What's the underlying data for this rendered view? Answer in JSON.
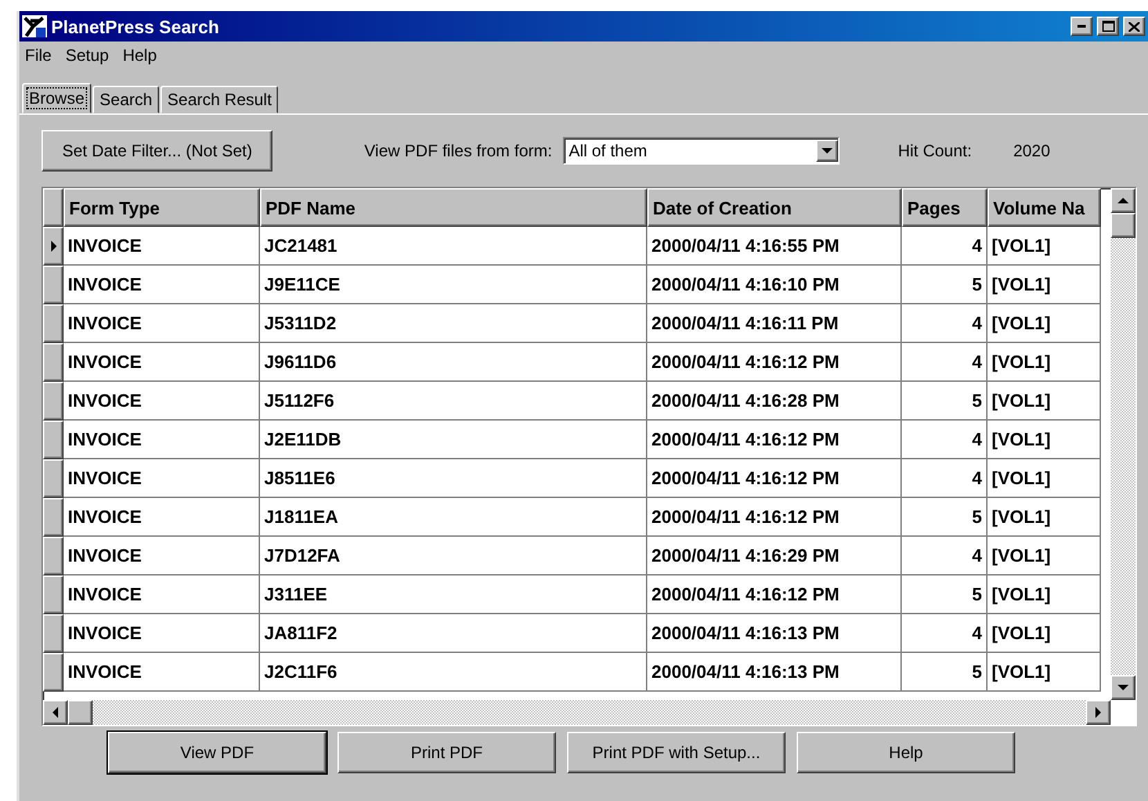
{
  "window": {
    "title": "PlanetPress Search"
  },
  "menu": [
    "File",
    "Setup",
    "Help"
  ],
  "tabs": [
    {
      "label": "Browse",
      "selected": true
    },
    {
      "label": "Search",
      "selected": false
    },
    {
      "label": "Search Result",
      "selected": false
    }
  ],
  "toolbar": {
    "date_filter_button": "Set Date Filter... (Not Set)",
    "form_label": "View PDF files from form:",
    "form_value": "All of them",
    "hit_count_label": "Hit Count:",
    "hit_count": "2020"
  },
  "table": {
    "columns": [
      "Form Type",
      "PDF Name",
      "Date of Creation",
      "Pages",
      "Volume Na"
    ],
    "rows": [
      {
        "selected": true,
        "cells": [
          "INVOICE",
          "JC21481",
          "2000/04/11 4:16:55 PM",
          "4",
          "[VOL1]"
        ]
      },
      {
        "selected": false,
        "cells": [
          "INVOICE",
          "J9E11CE",
          "2000/04/11 4:16:10 PM",
          "5",
          "[VOL1]"
        ]
      },
      {
        "selected": false,
        "cells": [
          "INVOICE",
          "J5311D2",
          "2000/04/11 4:16:11 PM",
          "4",
          "[VOL1]"
        ]
      },
      {
        "selected": false,
        "cells": [
          "INVOICE",
          "J9611D6",
          "2000/04/11 4:16:12 PM",
          "4",
          "[VOL1]"
        ]
      },
      {
        "selected": false,
        "cells": [
          "INVOICE",
          "J5112F6",
          "2000/04/11 4:16:28 PM",
          "5",
          "[VOL1]"
        ]
      },
      {
        "selected": false,
        "cells": [
          "INVOICE",
          "J2E11DB",
          "2000/04/11 4:16:12 PM",
          "4",
          "[VOL1]"
        ]
      },
      {
        "selected": false,
        "cells": [
          "INVOICE",
          "J8511E6",
          "2000/04/11 4:16:12 PM",
          "4",
          "[VOL1]"
        ]
      },
      {
        "selected": false,
        "cells": [
          "INVOICE",
          "J1811EA",
          "2000/04/11 4:16:12 PM",
          "5",
          "[VOL1]"
        ]
      },
      {
        "selected": false,
        "cells": [
          "INVOICE",
          "J7D12FA",
          "2000/04/11 4:16:29 PM",
          "4",
          "[VOL1]"
        ]
      },
      {
        "selected": false,
        "cells": [
          "INVOICE",
          "J311EE",
          "2000/04/11 4:16:12 PM",
          "5",
          "[VOL1]"
        ]
      },
      {
        "selected": false,
        "cells": [
          "INVOICE",
          "JA811F2",
          "2000/04/11 4:16:13 PM",
          "4",
          "[VOL1]"
        ]
      },
      {
        "selected": false,
        "cells": [
          "INVOICE",
          "J2C11F6",
          "2000/04/11 4:16:13 PM",
          "5",
          "[VOL1]"
        ]
      }
    ]
  },
  "buttons": [
    "View PDF",
    "Print PDF",
    "Print PDF with Setup...",
    "Help"
  ]
}
